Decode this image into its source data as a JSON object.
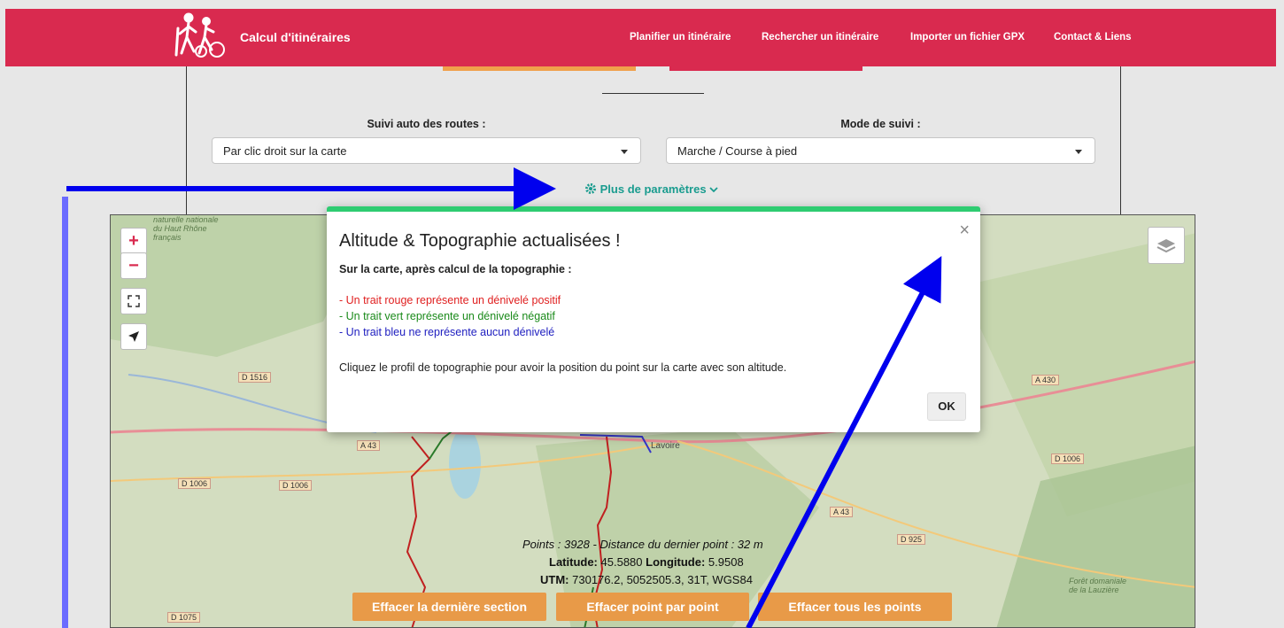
{
  "header": {
    "title": "Calcul d'itinéraires",
    "nav": [
      "Planifier un itinéraire",
      "Rechercher un itinéraire",
      "Importer un fichier GPX",
      "Contact & Liens"
    ]
  },
  "form": {
    "suivi_label": "Suivi auto des routes :",
    "suivi_value": "Par clic droit sur la carte",
    "mode_label": "Mode de suivi :",
    "mode_value": "Marche / Course à pied",
    "more_params": "Plus de paramètres"
  },
  "map": {
    "zoom_in": "+",
    "zoom_out": "−",
    "labels": {
      "d1516": "D 1516",
      "a43a": "A 43",
      "d1006a": "D 1006",
      "d1006b": "D 1006",
      "d1006c": "D 1006",
      "a430": "A 430",
      "a43b": "A 43",
      "d925": "D 925",
      "d1075": "D 1075",
      "town": "Lavoire",
      "forest": "Forêt domaniale de la Lauzière",
      "reserve": "naturelle nationale du Haut Rhône français"
    },
    "info": {
      "points": "Points : 3928 - Distance du dernier point : 32 m",
      "lat_label": "Latitude:",
      "lat_value": "45.5880",
      "lon_label": "Longitude:",
      "lon_value": "5.9508",
      "utm_label": "UTM:",
      "utm_value": "730176.2, 5052505.3, 31T, WGS84"
    },
    "buttons": [
      "Effacer la dernière section",
      "Effacer point par point",
      "Effacer tous les points"
    ]
  },
  "modal": {
    "title": "Altitude & Topographie actualisées !",
    "subtitle": "Sur la carte, après calcul de la topographie :",
    "line_red": "- Un trait rouge représente un dénivelé positif",
    "line_green": "- Un trait vert représente un dénivelé négatif",
    "line_blue": "- Un trait bleu ne représente aucun dénivelé",
    "info": "Cliquez le profil de topographie pour avoir la position du point sur la carte avec son altitude.",
    "ok": "OK",
    "close": "×"
  },
  "colors": {
    "brand": "#d92a4f",
    "accent_teal": "#1a9c8f",
    "orange_button": "#e89a48",
    "modal_top": "#2ecc71",
    "annotation_arrow": "#0000ee"
  },
  "icons": [
    "hikers-logo-icon",
    "gear-icon",
    "chevron-down-icon",
    "fullscreen-icon",
    "locate-arrow-icon",
    "layers-icon",
    "close-icon"
  ]
}
